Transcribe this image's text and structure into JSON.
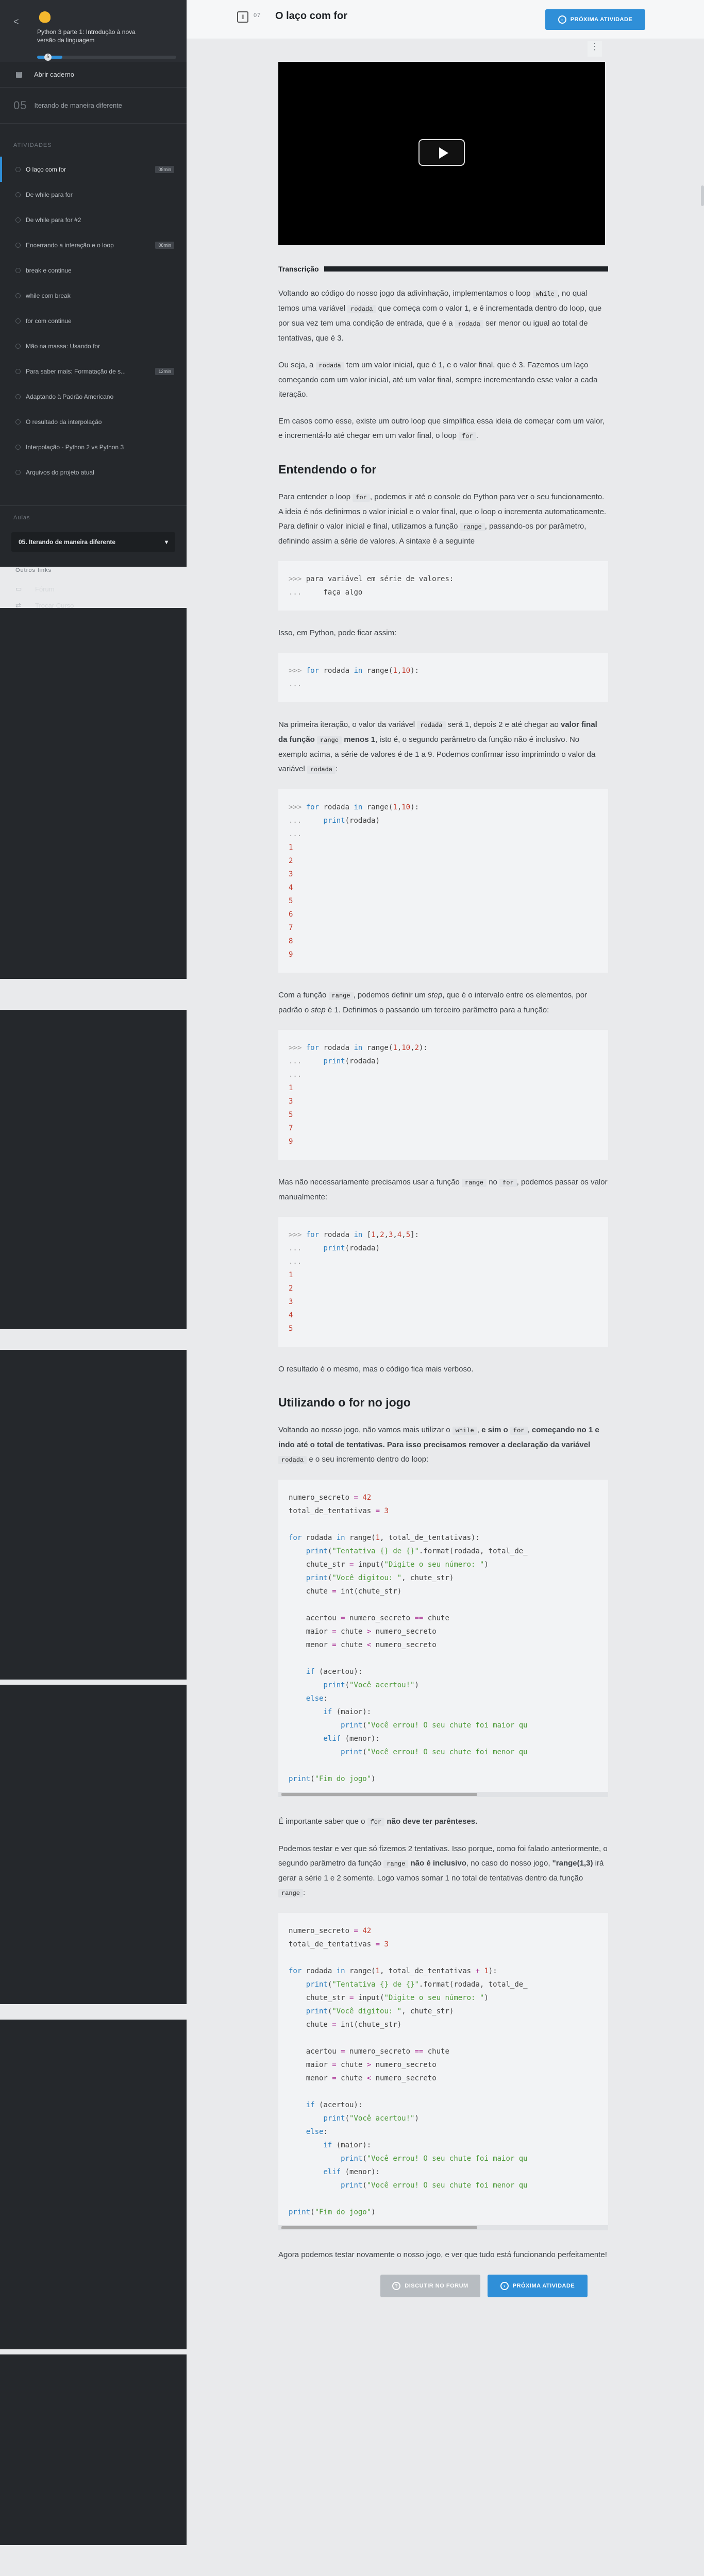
{
  "sidebar": {
    "course_title": "Python 3 parte 1: Introdução à nova versão da linguagem",
    "progress_badge": "5",
    "progress_fraction": 0.18,
    "open_notebook": "Abrir caderno",
    "prev_num": "05",
    "prev_title": "Iterando de maneira diferente",
    "section_label": "Atividades",
    "lessons": [
      {
        "title": "O laço com for",
        "dur": "08min"
      },
      {
        "title": "De while para for",
        "dur": ""
      },
      {
        "title": "De while para for #2",
        "dur": ""
      },
      {
        "title": "Encerrando a interação e o loop",
        "dur": "08min"
      },
      {
        "title": "break e continue",
        "dur": ""
      },
      {
        "title": "while com break",
        "dur": ""
      },
      {
        "title": "for com continue",
        "dur": ""
      },
      {
        "title": "Mão na massa: Usando for",
        "dur": ""
      },
      {
        "title": "Para saber mais: Formatação de s...",
        "dur": "12min"
      },
      {
        "title": "Adaptando à Padrão Americano",
        "dur": ""
      },
      {
        "title": "O resultado da interpolação",
        "dur": ""
      },
      {
        "title": "Interpolação - Python 2 vs Python 3",
        "dur": ""
      },
      {
        "title": "Arquivos do projeto atual",
        "dur": ""
      }
    ],
    "cursos_label": "Aulas",
    "select_value": "05. Iterando de maneira diferente",
    "outros_label": "Outros links",
    "forum": "Fórum",
    "trocar": "Trocar Curso"
  },
  "topbar": {
    "num": "07",
    "title": "O laço com for",
    "next": "PRÓXIMA ATIVIDADE"
  },
  "content": {
    "transcricao": "Transcrição",
    "h_entendendo": "Entendendo o for",
    "h_utilizando": "Utilizando o for no jogo",
    "bottom_forum": "DISCUTIR NO FORUM",
    "bottom_next": "PRÓXIMA ATIVIDADE",
    "output_1_10": [
      "1",
      "2",
      "3",
      "4",
      "5",
      "6",
      "7",
      "8",
      "9"
    ],
    "output_step": [
      "1",
      "3",
      "5",
      "7",
      "9"
    ],
    "output_list": [
      "1",
      "2",
      "3",
      "4",
      "5"
    ]
  },
  "colors": {
    "accent": "#2f8fd8",
    "sidebar": "#25282c"
  }
}
